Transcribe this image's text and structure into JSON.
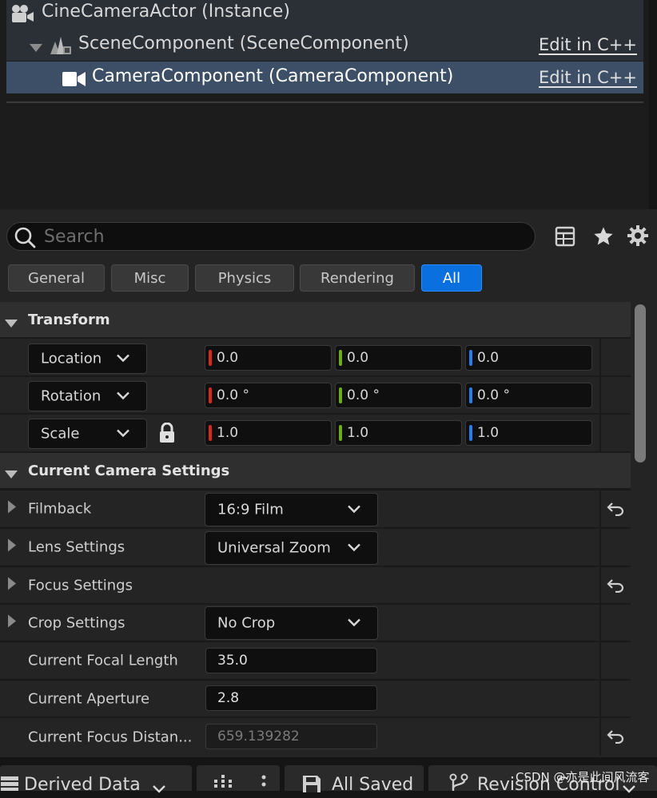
{
  "tree": {
    "actor_label": "CineCameraActor (Instance)",
    "scene_label": "SceneComponent (SceneComponent)",
    "camera_label": "CameraComponent (CameraComponent)",
    "edit_cpp": "Edit in C++"
  },
  "search": {
    "placeholder": "Search"
  },
  "filter_tabs": [
    {
      "label": "General",
      "active": false
    },
    {
      "label": "Misc",
      "active": false
    },
    {
      "label": "Physics",
      "active": false
    },
    {
      "label": "Rendering",
      "active": false
    },
    {
      "label": "All",
      "active": true
    }
  ],
  "transform": {
    "title": "Transform",
    "rows": [
      {
        "label": "Location",
        "x": "0.0",
        "y": "0.0",
        "z": "0.0"
      },
      {
        "label": "Rotation",
        "x": "0.0 °",
        "y": "0.0 °",
        "z": "0.0 °"
      },
      {
        "label": "Scale",
        "x": "1.0",
        "y": "1.0",
        "z": "1.0"
      }
    ]
  },
  "camera_settings": {
    "title": "Current Camera Settings",
    "filmback": {
      "label": "Filmback",
      "value": "16:9 Film"
    },
    "lens": {
      "label": "Lens Settings",
      "value": "Universal Zoom"
    },
    "focus": {
      "label": "Focus Settings"
    },
    "crop": {
      "label": "Crop Settings",
      "value": "No Crop"
    },
    "focal_length": {
      "label": "Current Focal Length",
      "value": "35.0"
    },
    "aperture": {
      "label": "Current Aperture",
      "value": "2.8"
    },
    "focus_distance": {
      "label": "Current Focus Distan...",
      "value": "659.139282"
    }
  },
  "statusbar": {
    "derived_data": "Derived Data",
    "all_saved": "All Saved",
    "revision_control": "Revision Control"
  },
  "watermark": "CSDN @亦是此间风流客",
  "colors": {
    "x_axis": "#d22a1e",
    "y_axis": "#6cad1b",
    "z_axis": "#2a7bea",
    "accent": "#0a70e0",
    "selected_row": "#3c4f66"
  }
}
